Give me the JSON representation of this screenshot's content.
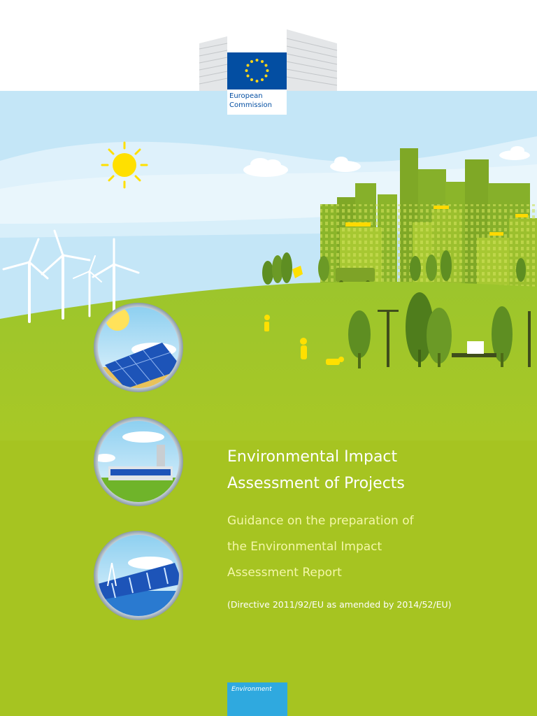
{
  "header": {
    "org_line1": "European",
    "org_line2": "Commission"
  },
  "title": {
    "line1": "Environmental Impact",
    "line2": "Assessment of Projects"
  },
  "subtitle": {
    "line1": "Guidance on the preparation of",
    "line2": "the Environmental Impact",
    "line3": "Assessment Report"
  },
  "directive": "(Directive 2011/92/EU as amended by 2014/52/EU)",
  "badge": {
    "label": "Environment"
  },
  "colors": {
    "background_green": "#a6c421",
    "sky": "#c4e6f7",
    "eu_blue": "#034ea2",
    "subtitle_yellow": "#f4f7a8",
    "badge_blue": "#2fa9df"
  },
  "icons": [
    "sun-icon",
    "wind-turbine-icon",
    "solar-panel-medallion",
    "factory-medallion",
    "hydro-dam-medallion",
    "city-skyline-icon",
    "eu-flag-icon"
  ]
}
